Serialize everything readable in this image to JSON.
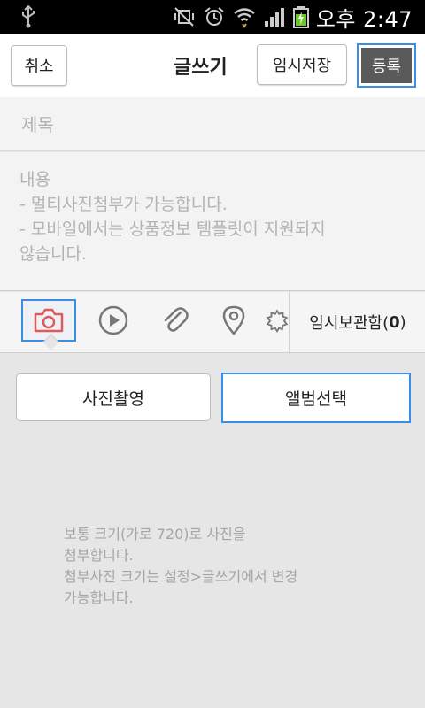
{
  "status_bar": {
    "time": "오후 2:47",
    "icons": [
      "usb-icon",
      "mute-vibrate-icon",
      "alarm-icon",
      "wifi-icon",
      "signal-icon",
      "battery-charging-icon"
    ]
  },
  "header": {
    "cancel_label": "취소",
    "title": "글쓰기",
    "save_draft_label": "임시저장",
    "register_label": "등록"
  },
  "form": {
    "title_placeholder": "제목",
    "content_placeholder": "내용\n- 멀티사진첨부가 가능합니다.\n- 모바일에서는 상품정보 템플릿이 지원되지\n않습니다."
  },
  "toolbar": {
    "tools": [
      "camera-icon",
      "video-play-icon",
      "attach-clip-icon",
      "location-pin-icon",
      "sticker-icon"
    ],
    "draft_box_label": "임시보관함(",
    "draft_box_count": "0",
    "draft_box_close": ")"
  },
  "photo_panel": {
    "take_photo_label": "사진촬영",
    "album_select_label": "앨범선택",
    "info_text": "보통 크기(가로 720)로 사진을\n첨부합니다.\n첨부사진 크기는 설정>글쓰기에서 변경\n가능합니다."
  },
  "colors": {
    "accent_blue": "#3a8ee6",
    "camera_red": "#e05a5a",
    "register_bg": "#5a5a5a",
    "panel_bg": "#e6e6e6"
  }
}
